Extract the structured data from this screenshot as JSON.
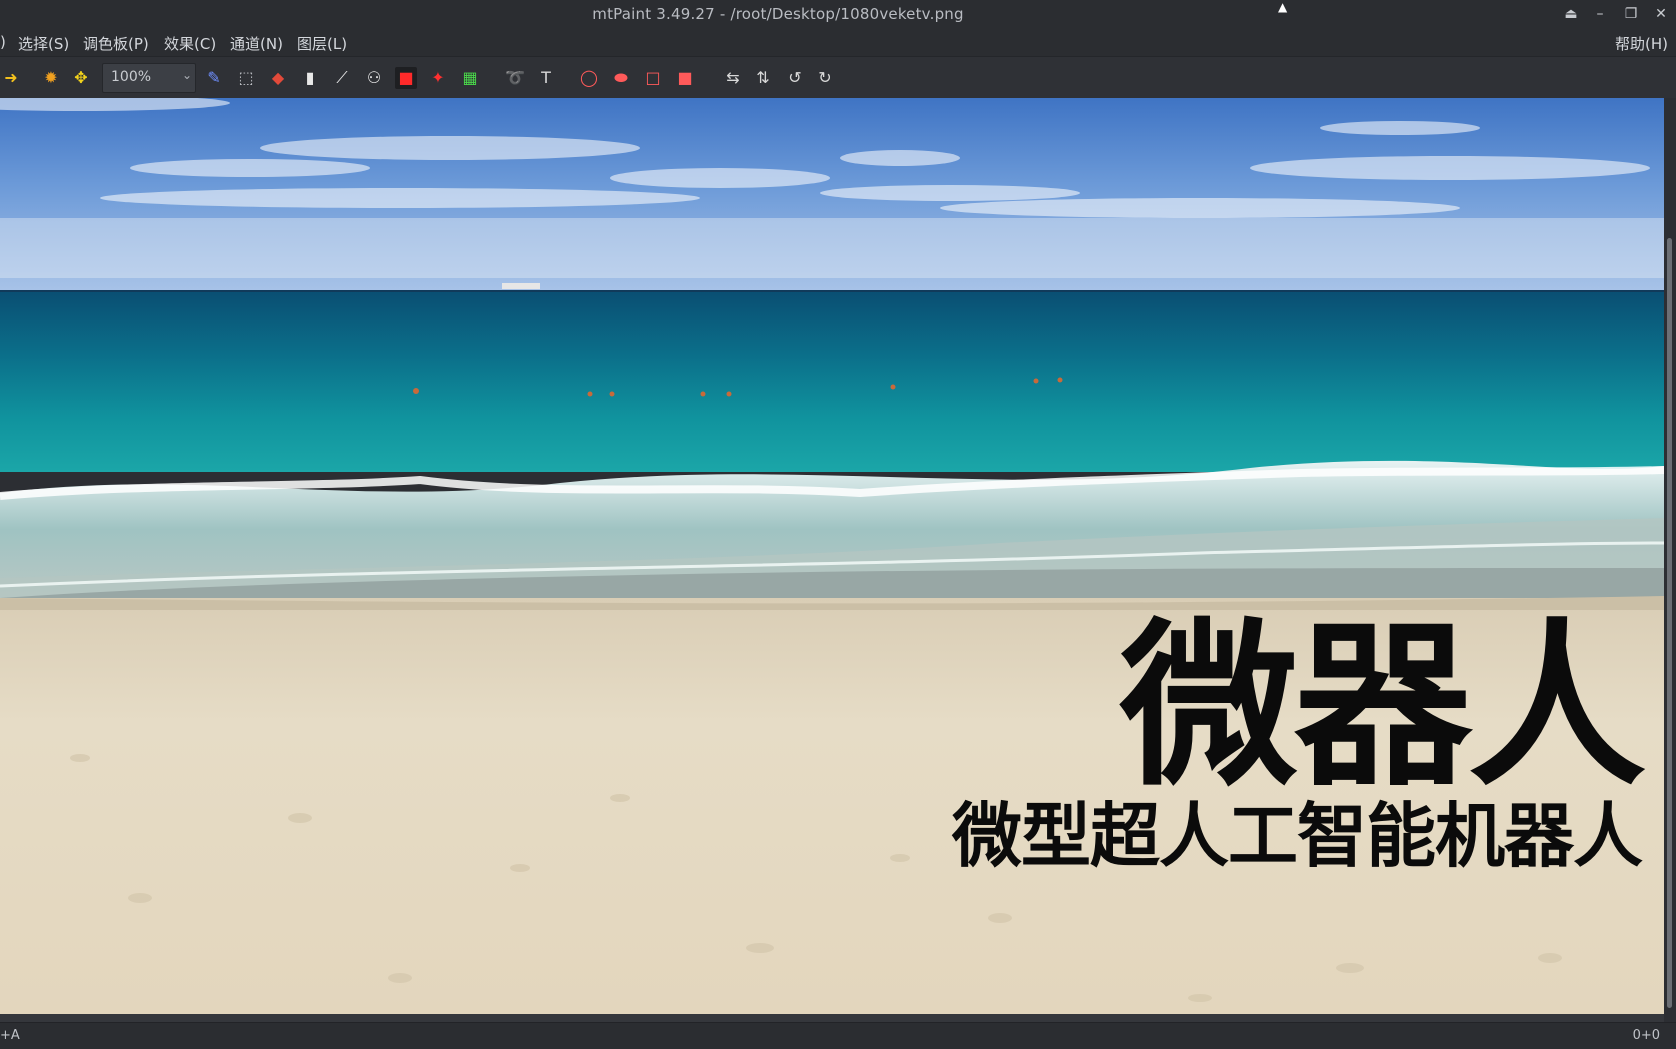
{
  "window": {
    "title": "mtPaint 3.49.27 - /root/Desktop/1080veketv.png",
    "controls": [
      "⏏",
      "–",
      "❐",
      "✕"
    ]
  },
  "menubar": {
    "items": [
      ")",
      "选择(S)",
      "调色板(P)",
      "效果(C)",
      "通道(N)",
      "图层(L)"
    ],
    "help": "帮助(H)"
  },
  "toolbar": {
    "zoom_value": "100%",
    "tools": [
      "arrow-right",
      "sun",
      "pan",
      "pencil",
      "dotted-rect",
      "fill",
      "line",
      "brush",
      "symmetry",
      "select-rect",
      "clone",
      "palette-cursor",
      "lasso",
      "text",
      "ellipse-outline",
      "ellipse-filled",
      "rect-outline",
      "rect-filled",
      "flip-1",
      "flip-2",
      "rotate-1",
      "rotate-2"
    ]
  },
  "canvas": {
    "headline": "微器人",
    "subheadline": "微型超人工智能机器人"
  },
  "statusbar": {
    "left": "+A",
    "right": "0+0"
  },
  "colors": {
    "chrome_bg": "#2b2d31",
    "sky": "#5f8fd2",
    "sea": "#0b7b8f",
    "sand": "#e7dcc7",
    "text": "#0b0b0b"
  }
}
